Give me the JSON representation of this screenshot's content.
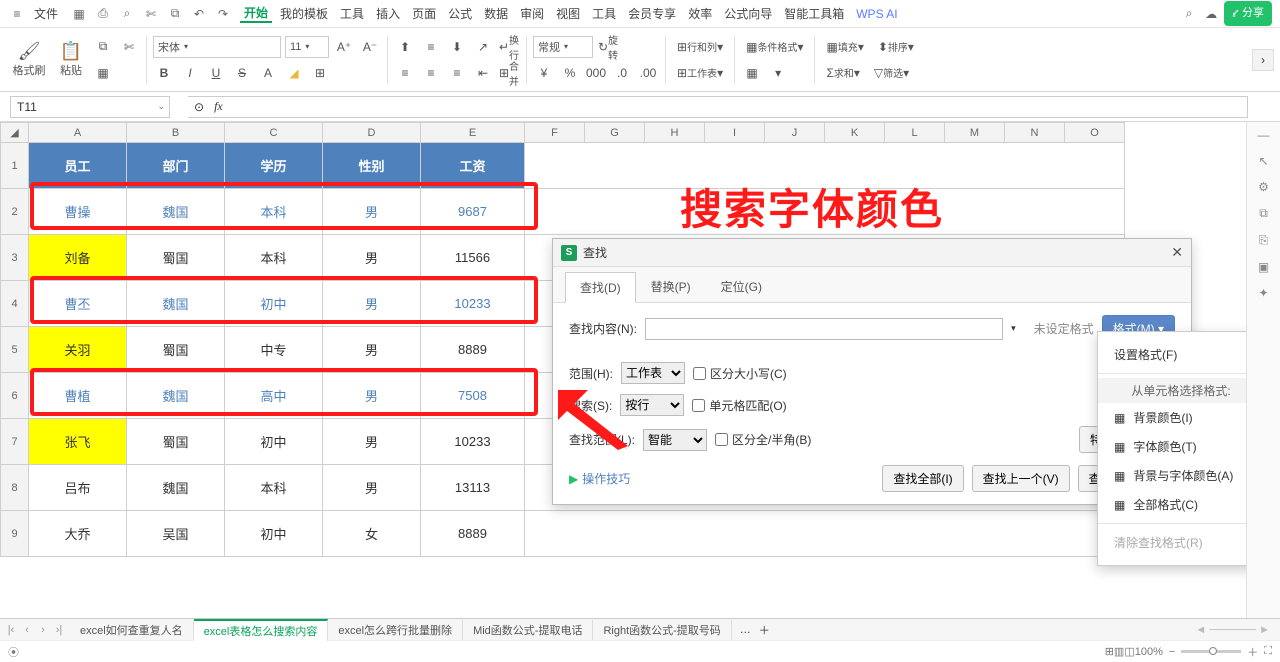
{
  "topbar": {
    "file_menu": "文件",
    "menus": [
      "开始",
      "我的模板",
      "工具",
      "插入",
      "页面",
      "公式",
      "数据",
      "审阅",
      "视图",
      "工具",
      "会员专享",
      "效率",
      "公式向导",
      "智能工具箱"
    ],
    "active_menu": "开始",
    "ai": "WPS AI",
    "share": "分享"
  },
  "ribbon": {
    "format_painter": "格式刷",
    "paste": "粘贴",
    "font_name": "宋体",
    "font_size": "11",
    "number_format": "常规",
    "bold": "B",
    "italic": "I",
    "underline": "U",
    "strike": "S",
    "wrap": "换行",
    "merge": "合并",
    "rotate": "旋转",
    "rowcol": "行和列",
    "worksheet": "工作表",
    "cond": "条件格式",
    "fill": "填充",
    "sort": "排序",
    "sum": "求和",
    "filter": "筛选"
  },
  "namebox": {
    "ref": "T11",
    "fx": "fx"
  },
  "columns": [
    "A",
    "B",
    "C",
    "D",
    "E",
    "F",
    "G",
    "H",
    "I",
    "J",
    "K",
    "L",
    "M",
    "N",
    "O"
  ],
  "rows": [
    "1",
    "2",
    "3",
    "4",
    "5",
    "6",
    "7",
    "8",
    "9"
  ],
  "table": {
    "headers": [
      "员工",
      "部门",
      "学历",
      "性别",
      "工资"
    ],
    "data": [
      {
        "c": [
          "曹操",
          "魏国",
          "本科",
          "男",
          "9687"
        ],
        "blue": true
      },
      {
        "c": [
          "刘备",
          "蜀国",
          "本科",
          "男",
          "11566"
        ],
        "yellow": true
      },
      {
        "c": [
          "曹丕",
          "魏国",
          "初中",
          "男",
          "10233"
        ],
        "blue": true
      },
      {
        "c": [
          "关羽",
          "蜀国",
          "中专",
          "男",
          "8889"
        ],
        "yellow": true
      },
      {
        "c": [
          "曹植",
          "魏国",
          "高中",
          "男",
          "7508"
        ],
        "blue": true
      },
      {
        "c": [
          "张飞",
          "蜀国",
          "初中",
          "男",
          "10233"
        ],
        "yellow": true
      },
      {
        "c": [
          "吕布",
          "魏国",
          "本科",
          "男",
          "13113"
        ]
      },
      {
        "c": [
          "大乔",
          "吴国",
          "初中",
          "女",
          "8889"
        ]
      }
    ]
  },
  "banner": "搜索字体颜色",
  "find_dialog": {
    "title": "查找",
    "tabs": [
      "查找(D)",
      "替换(P)",
      "定位(G)"
    ],
    "active_tab": "查找(D)",
    "content_label": "查找内容(N):",
    "format_state": "未设定格式",
    "format_btn": "格式(M)",
    "scope_label": "范围(H):",
    "scope_val": "工作表",
    "search_label": "搜索(S):",
    "search_val": "按行",
    "lookin_label": "查找范围(L):",
    "lookin_val": "智能",
    "chk_case": "区分大小写(C)",
    "chk_cell": "单元格匹配(O)",
    "chk_width": "区分全/半角(B)",
    "special_btn": "特殊内容(U)",
    "find_all": "查找全部(I)",
    "find_prev": "查找上一个(V)",
    "find_next": "查找下一个(F)",
    "play_tip": "操作技巧"
  },
  "fmt_menu": {
    "set_format": "设置格式(F)",
    "from_cell_header": "从单元格选择格式:",
    "bg_color": "背景颜色(I)",
    "font_color": "字体颜色(T)",
    "bg_and_font": "背景与字体颜色(A)",
    "all_format": "全部格式(C)",
    "clear": "清除查找格式(R)"
  },
  "sheets": {
    "tabs": [
      "excel如何查重复人名",
      "excel表格怎么搜索内容",
      "excel怎么跨行批量删除",
      "Mid函数公式-提取电话",
      "Right函数公式-提取号码"
    ],
    "active": "excel表格怎么搜索内容"
  },
  "status": {
    "zoom": "100%"
  }
}
